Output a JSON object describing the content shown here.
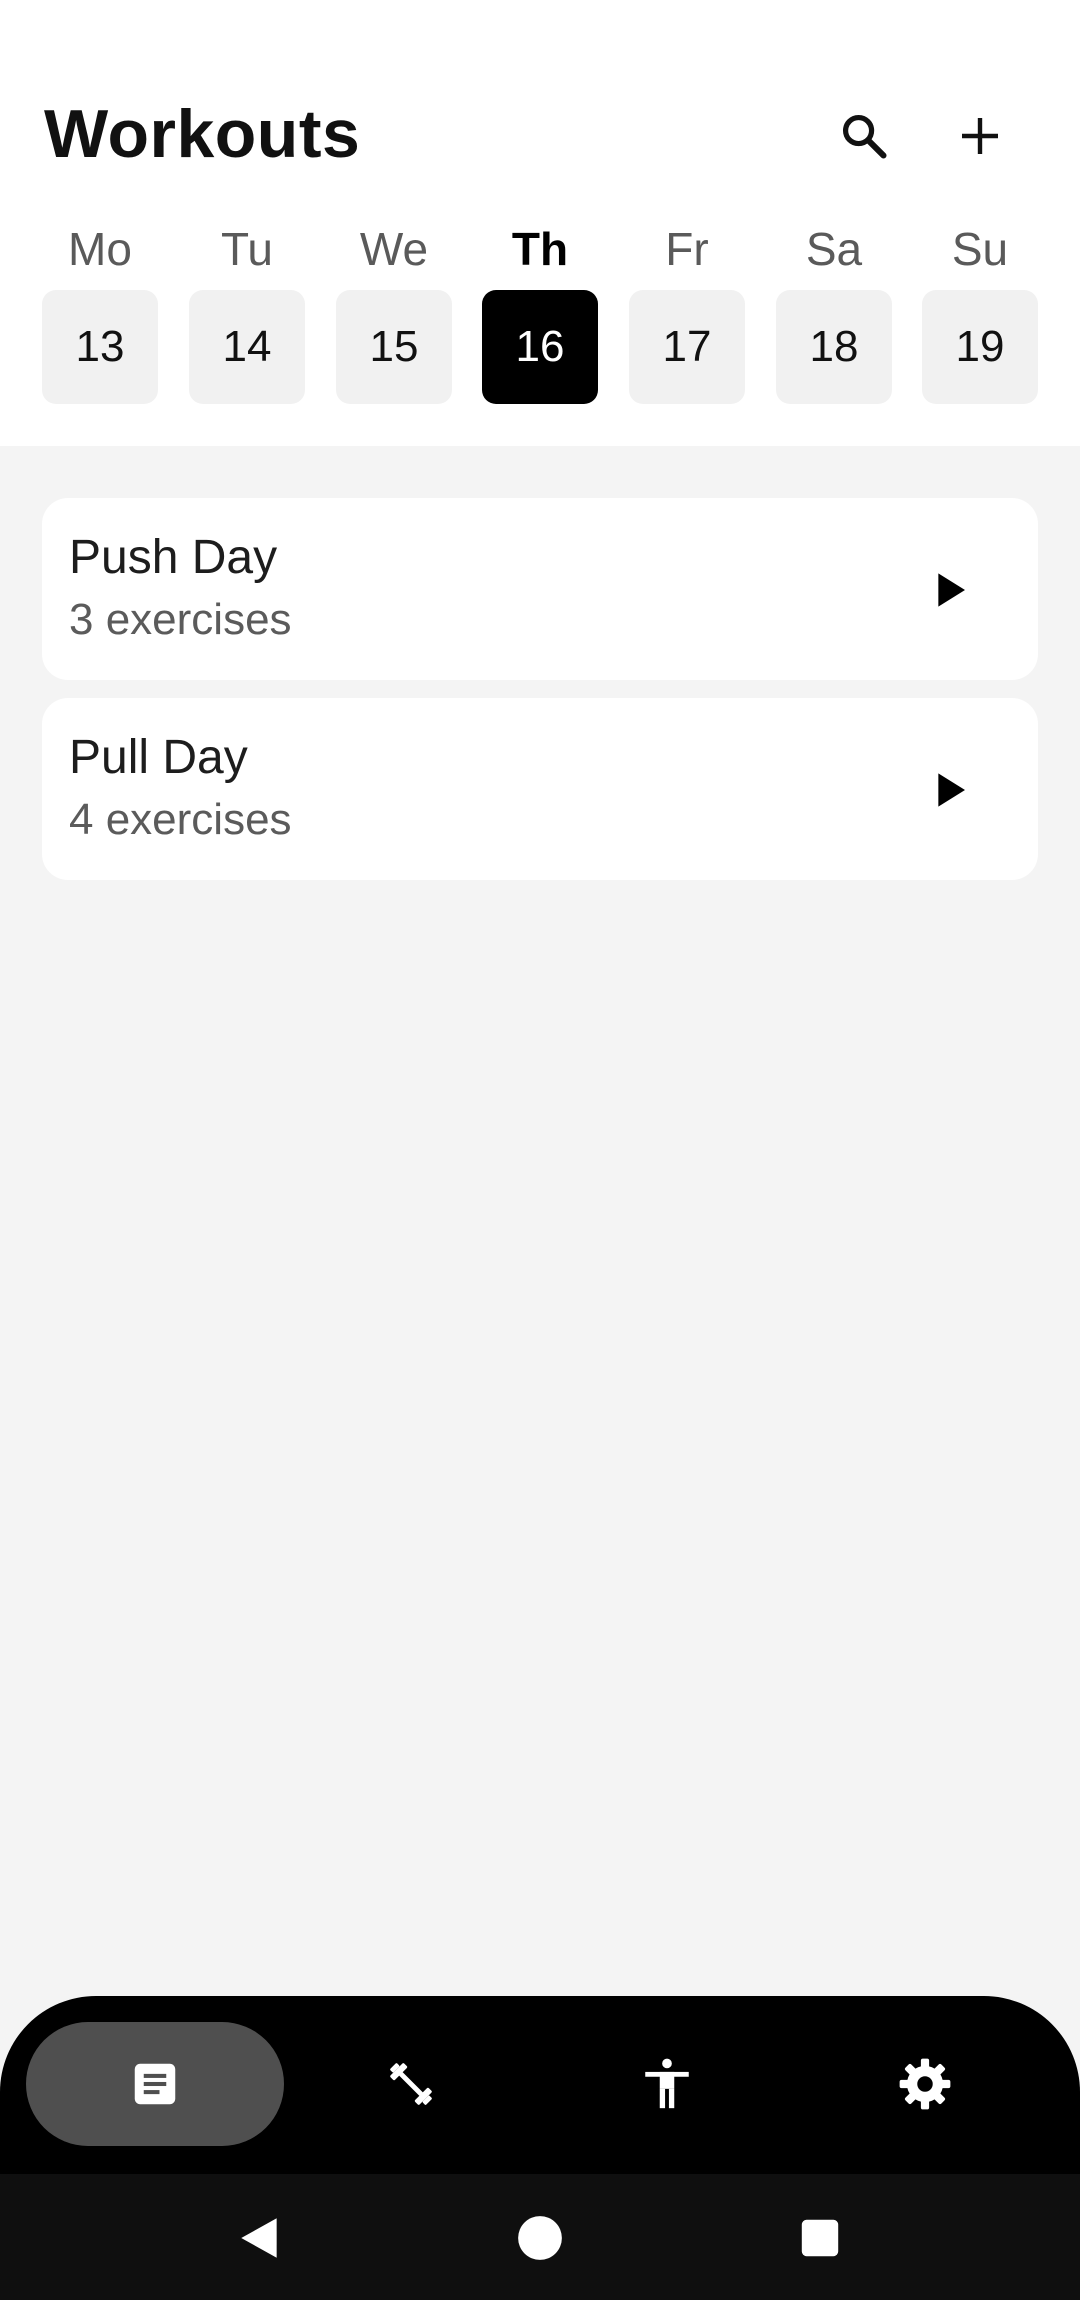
{
  "header": {
    "title": "Workouts",
    "search_icon": "search-icon",
    "add_icon": "plus-icon"
  },
  "week": {
    "days": [
      {
        "name": "Mo",
        "num": "13",
        "selected": false
      },
      {
        "name": "Tu",
        "num": "14",
        "selected": false
      },
      {
        "name": "We",
        "num": "15",
        "selected": false
      },
      {
        "name": "Th",
        "num": "16",
        "selected": true
      },
      {
        "name": "Fr",
        "num": "17",
        "selected": false
      },
      {
        "name": "Sa",
        "num": "18",
        "selected": false
      },
      {
        "name": "Su",
        "num": "19",
        "selected": false
      }
    ]
  },
  "workouts": [
    {
      "title": "Push Day",
      "subtitle": "3 exercises",
      "icon": "play-icon"
    },
    {
      "title": "Pull Day",
      "subtitle": "4 exercises",
      "icon": "play-icon"
    }
  ],
  "bottom_nav": {
    "items": [
      {
        "icon": "article-icon",
        "active": true
      },
      {
        "icon": "dumbbell-icon",
        "active": false
      },
      {
        "icon": "accessibility-icon",
        "active": false
      },
      {
        "icon": "gear-icon",
        "active": false
      }
    ]
  },
  "system_nav": {
    "items": [
      "back-icon",
      "home-icon",
      "recents-icon"
    ]
  },
  "colors": {
    "background": "#f4f4f4",
    "surface": "#ffffff",
    "selected_day": "#000000",
    "nav_bar": "#000000",
    "nav_active": "#4f4f4f"
  }
}
